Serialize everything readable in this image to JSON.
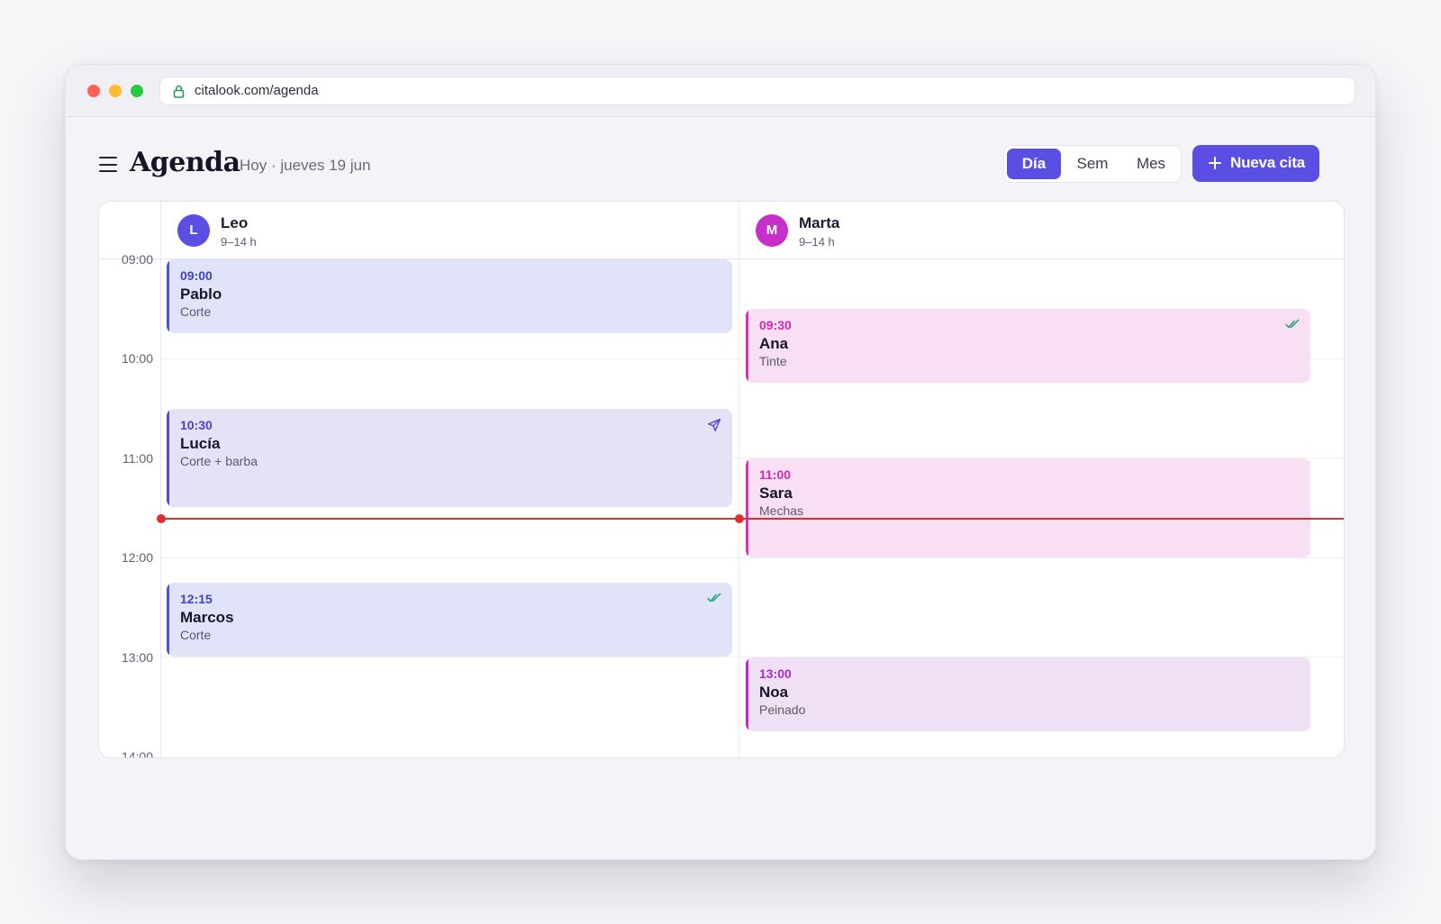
{
  "browser": {
    "url": "citalook.com/agenda",
    "icons": {
      "lock": "lock-icon"
    }
  },
  "header": {
    "title": "Agenda",
    "date": "Hoy · jueves 19 jun",
    "menu_icon": "hamburger-menu-icon",
    "view_options": [
      {
        "label": "Día",
        "active": true
      },
      {
        "label": "Sem",
        "active": false
      },
      {
        "label": "Mes",
        "active": false
      }
    ],
    "new_button": {
      "label": "Nueva cita",
      "icon": "plus-icon"
    }
  },
  "colors": {
    "accent": "#5b4fe3",
    "leo_avatar": "#5b4fe3",
    "marta_avatar": "#c730c8",
    "now_line": "#e02d2d",
    "confirmed_check": "#1f9d6e"
  },
  "time_labels": [
    "09:00",
    "10:00",
    "11:00",
    "12:00",
    "13:00",
    "14:00"
  ],
  "staff": [
    {
      "initial": "L",
      "name": "Leo",
      "hours": "9–14 h",
      "appointments": [
        {
          "time": "09:00",
          "client": "Pablo",
          "service": "Corte",
          "status_icon": ""
        },
        {
          "time": "10:30",
          "client": "Lucía",
          "service": "Corte + barba",
          "status_icon": "send-icon"
        },
        {
          "time": "12:15",
          "client": "Marcos",
          "service": "Corte",
          "status_icon": "double-check-icon"
        }
      ]
    },
    {
      "initial": "M",
      "name": "Marta",
      "hours": "9–14 h",
      "appointments": [
        {
          "time": "09:30",
          "client": "Ana",
          "service": "Tinte",
          "status_icon": "double-check-icon"
        },
        {
          "time": "11:00",
          "client": "Sara",
          "service": "Mechas",
          "status_icon": ""
        },
        {
          "time": "13:00",
          "client": "Noa",
          "service": "Peinado",
          "status_icon": ""
        }
      ]
    }
  ]
}
